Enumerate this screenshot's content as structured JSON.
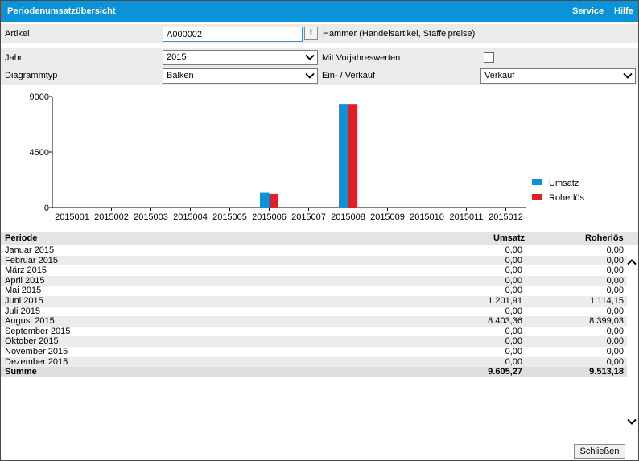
{
  "titlebar": {
    "title": "Periodenumsatzübersicht",
    "menu": [
      "Service",
      "Hilfe"
    ]
  },
  "form": {
    "artikel_label": "Artikel",
    "artikel_value": "A000002",
    "artikel_button": "!",
    "artikel_desc": "Hammer (Handelsartikel, Staffelpreise)",
    "jahr_label": "Jahr",
    "jahr_value": "2015",
    "vorjahr_label": "Mit Vorjahreswerten",
    "diagrammtyp_label": "Diagrammtyp",
    "diagrammtyp_value": "Balken",
    "einverkauf_label": "Ein- / Verkauf",
    "einverkauf_value": "Verkauf"
  },
  "chart_data": {
    "type": "bar",
    "categories": [
      "2015001",
      "2015002",
      "2015003",
      "2015004",
      "2015005",
      "2015006",
      "2015007",
      "2015008",
      "2015009",
      "2015010",
      "2015011",
      "2015012"
    ],
    "series": [
      {
        "name": "Umsatz",
        "color": "#0a93d8",
        "values": [
          0,
          0,
          0,
          0,
          0,
          1201.91,
          0,
          8403.36,
          0,
          0,
          0,
          0
        ]
      },
      {
        "name": "Roherlös",
        "color": "#dd1f26",
        "values": [
          0,
          0,
          0,
          0,
          0,
          1114.15,
          0,
          8399.03,
          0,
          0,
          0,
          0
        ]
      }
    ],
    "ylim": [
      0,
      9000
    ],
    "yticks": [
      "0",
      "4500",
      "9000"
    ],
    "legend": "right"
  },
  "table": {
    "headers": [
      "Periode",
      "Umsatz",
      "Roherlös"
    ],
    "rows": [
      [
        "Januar 2015",
        "0,00",
        "0,00"
      ],
      [
        "Februar 2015",
        "0,00",
        "0,00"
      ],
      [
        "März 2015",
        "0,00",
        "0,00"
      ],
      [
        "April 2015",
        "0,00",
        "0,00"
      ],
      [
        "Mai 2015",
        "0,00",
        "0,00"
      ],
      [
        "Juni 2015",
        "1.201,91",
        "1.114,15"
      ],
      [
        "Juli 2015",
        "0,00",
        "0,00"
      ],
      [
        "August 2015",
        "8.403,36",
        "8.399,03"
      ],
      [
        "September 2015",
        "0,00",
        "0,00"
      ],
      [
        "Oktober 2015",
        "0,00",
        "0,00"
      ],
      [
        "November 2015",
        "0,00",
        "0,00"
      ],
      [
        "Dezember 2015",
        "0,00",
        "0,00"
      ]
    ],
    "sum": [
      "Summe",
      "9.605,27",
      "9.513,18"
    ]
  },
  "footer": {
    "close_label": "Schließen"
  }
}
